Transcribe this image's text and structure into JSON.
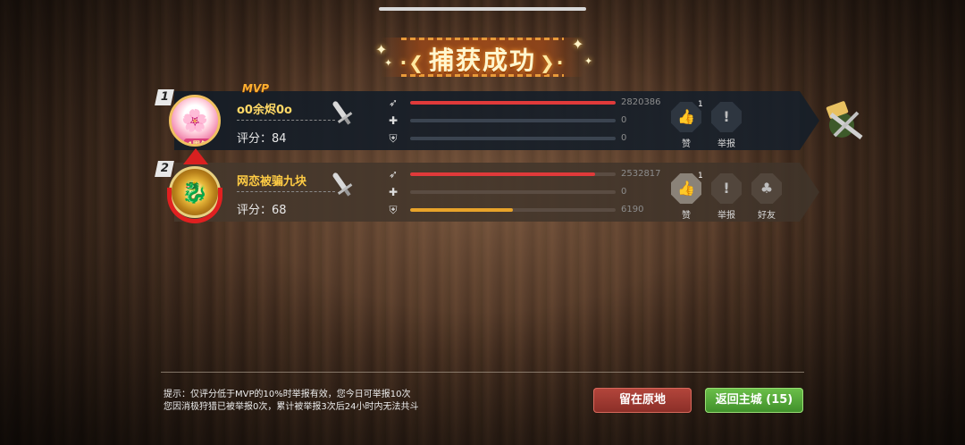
{
  "title": {
    "text": "捕获成功",
    "deco_left": "·❮",
    "deco_right": "❯·"
  },
  "players": [
    {
      "rank": "1",
      "mvp": "MVP",
      "name": "o0余烬0o",
      "score_label": "评分：84",
      "avatar_badge": "4周年",
      "stats": [
        {
          "icon": "rocket-icon",
          "value": "2820386",
          "fill": 1.0,
          "color": "#e03a3a"
        },
        {
          "icon": "plus-icon",
          "value": "0",
          "fill": 0.0,
          "color": "#e03a3a"
        },
        {
          "icon": "shield-icon",
          "value": "0",
          "fill": 0.0,
          "color": "#e8a32a"
        }
      ],
      "actions": [
        {
          "key": "like",
          "glyph": "👍",
          "label": "赞",
          "count": "1"
        },
        {
          "key": "report",
          "glyph": "!",
          "label": "举报",
          "count": ""
        }
      ]
    },
    {
      "rank": "2",
      "name": "网恋被骗九块",
      "score_label": "评分：68",
      "stats": [
        {
          "icon": "rocket-icon",
          "value": "2532817",
          "fill": 0.9,
          "color": "#e03a3a"
        },
        {
          "icon": "plus-icon",
          "value": "0",
          "fill": 0.0,
          "color": "#e03a3a"
        },
        {
          "icon": "shield-icon",
          "value": "6190",
          "fill": 0.5,
          "color": "#e8a32a"
        }
      ],
      "actions": [
        {
          "key": "like",
          "glyph": "👍",
          "label": "赞",
          "count": "1"
        },
        {
          "key": "report",
          "glyph": "!",
          "label": "举报",
          "count": ""
        },
        {
          "key": "friend",
          "glyph": "♣",
          "label": "好友",
          "count": ""
        }
      ]
    }
  ],
  "tips": [
    "提示：仅评分低于MVP的10%时举报有效，您今日可举报10次",
    "您因消极狩猎已被举报0次，累计被举报3次后24小时内无法共斗"
  ],
  "buttons": {
    "stay": "留在原地",
    "back": "返回主城 (15)"
  }
}
